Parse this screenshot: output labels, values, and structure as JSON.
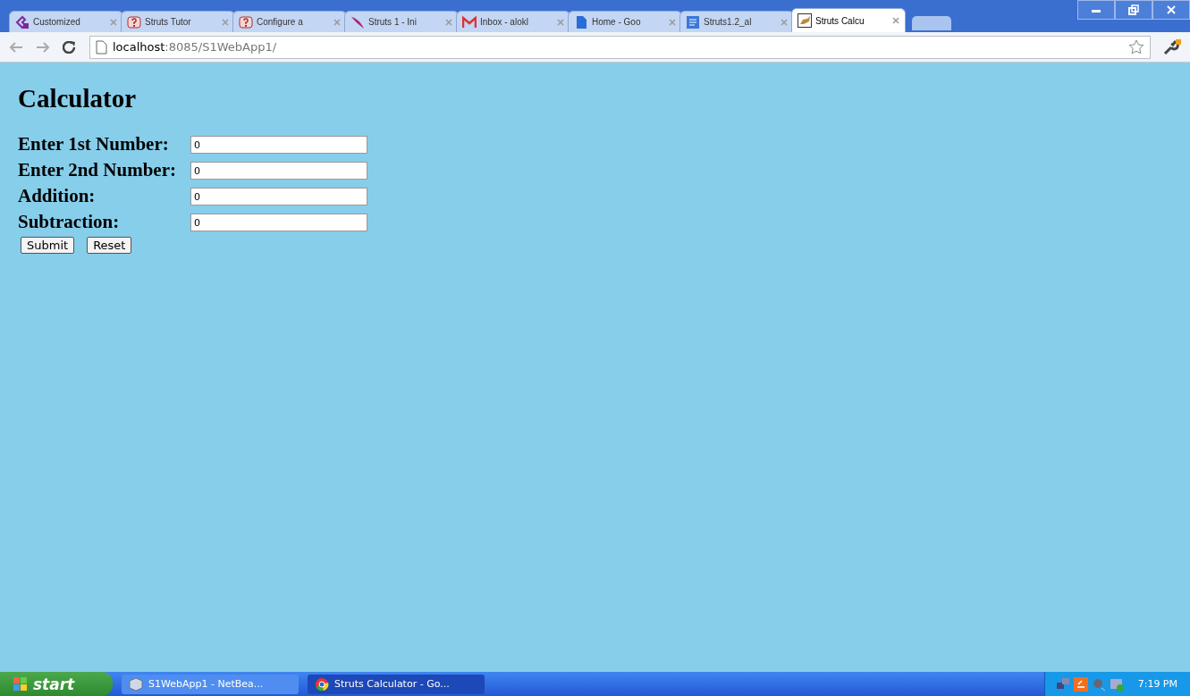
{
  "browser": {
    "tabs": [
      {
        "label": "Customized",
        "selected": false
      },
      {
        "label": "Struts Tutor",
        "selected": false
      },
      {
        "label": "Configure a",
        "selected": false
      },
      {
        "label": "Struts 1 - Ini",
        "selected": false
      },
      {
        "label": "Inbox - alokl",
        "selected": false
      },
      {
        "label": "Home - Goo",
        "selected": false
      },
      {
        "label": "Struts1.2_al",
        "selected": false
      },
      {
        "label": "Struts Calcu",
        "selected": true
      }
    ],
    "address": {
      "host": "localhost",
      "rest": ":8085/S1WebApp1/"
    }
  },
  "page": {
    "heading": "Calculator",
    "fields": [
      {
        "label": "Enter 1st Number:",
        "value": "0"
      },
      {
        "label": "Enter 2nd Number:",
        "value": "0"
      },
      {
        "label": "Addition:",
        "value": "0"
      },
      {
        "label": "Subtraction:",
        "value": "0"
      }
    ],
    "buttons": [
      "Submit",
      "Reset"
    ]
  },
  "taskbar": {
    "start": "start",
    "tasks": [
      {
        "label": "S1WebApp1 - NetBea...",
        "selected": false
      },
      {
        "label": "Struts Calculator - Go...",
        "selected": true
      }
    ],
    "clock": "7:19 PM"
  }
}
